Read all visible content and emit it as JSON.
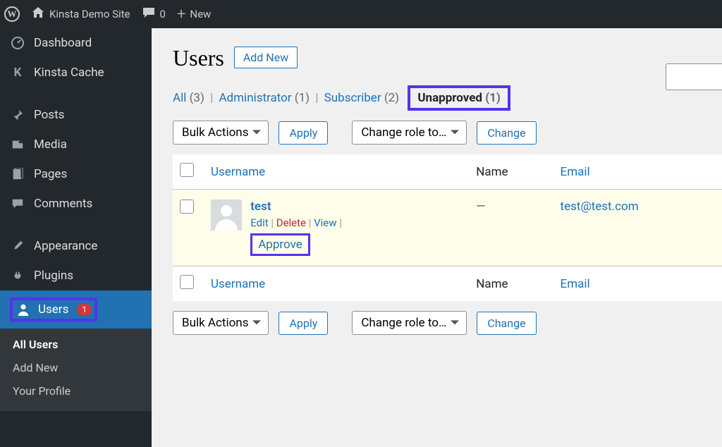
{
  "adminbar": {
    "site_name": "Kinsta Demo Site",
    "comments_count": "0",
    "new_label": "New"
  },
  "sidebar": {
    "items": [
      {
        "label": "Dashboard"
      },
      {
        "label": "Kinsta Cache"
      },
      {
        "label": "Posts"
      },
      {
        "label": "Media"
      },
      {
        "label": "Pages"
      },
      {
        "label": "Comments"
      },
      {
        "label": "Appearance"
      },
      {
        "label": "Plugins"
      },
      {
        "label": "Users",
        "badge": "1"
      }
    ],
    "submenu": [
      {
        "label": "All Users"
      },
      {
        "label": "Add New"
      },
      {
        "label": "Your Profile"
      }
    ]
  },
  "page": {
    "title": "Users",
    "add_new": "Add New"
  },
  "filters": {
    "all_label": "All",
    "all_count": "(3)",
    "admin_label": "Administrator",
    "admin_count": "(1)",
    "sub_label": "Subscriber",
    "sub_count": "(2)",
    "unapproved_label": "Unapproved",
    "unapproved_count": "(1)"
  },
  "actions": {
    "bulk": "Bulk Actions",
    "apply": "Apply",
    "change_role": "Change role to…",
    "change": "Change"
  },
  "table": {
    "col_username": "Username",
    "col_name": "Name",
    "col_email": "Email"
  },
  "row": {
    "username": "test",
    "edit": "Edit",
    "delete": "Delete",
    "view": "View",
    "approve": "Approve",
    "name": "—",
    "email": "test@test.com"
  }
}
